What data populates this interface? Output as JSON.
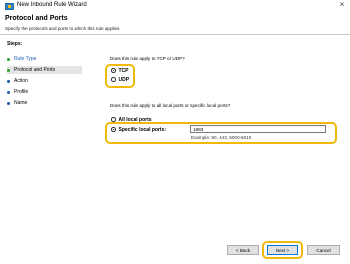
{
  "window": {
    "title": "New Inbound Rule Wizard",
    "close_glyph": "×",
    "icon": "firewall-rule-icon"
  },
  "header": {
    "title": "Protocol and Ports",
    "description": "Specify the protocols and ports to which this rule applies."
  },
  "steps": {
    "heading": "Steps:",
    "items": [
      {
        "label": "Rule Type",
        "state": "done"
      },
      {
        "label": "Protocol and Ports",
        "state": "current"
      },
      {
        "label": "Action",
        "state": "pending"
      },
      {
        "label": "Profile",
        "state": "pending"
      },
      {
        "label": "Name",
        "state": "pending"
      }
    ]
  },
  "protocol": {
    "question": "Does this rule apply to TCP or UDP?",
    "options": [
      {
        "label": "TCP",
        "selected": true
      },
      {
        "label": "UDP",
        "selected": false
      }
    ]
  },
  "ports": {
    "question": "Does this rule apply to all local ports or specific local ports?",
    "options": [
      {
        "label": "All local ports",
        "selected": false
      },
      {
        "label": "Specific local ports:",
        "selected": true
      }
    ],
    "value": "1883",
    "example": "Example: 80, 443, 5000-5010"
  },
  "buttons": {
    "back": "< Back",
    "next": "Next >",
    "cancel": "Cancel"
  },
  "colors": {
    "highlight": "#f0b90b",
    "link": "#1a5fb4",
    "done_dot": "#2e9e2e",
    "pending_dot": "#1e5aa8"
  }
}
